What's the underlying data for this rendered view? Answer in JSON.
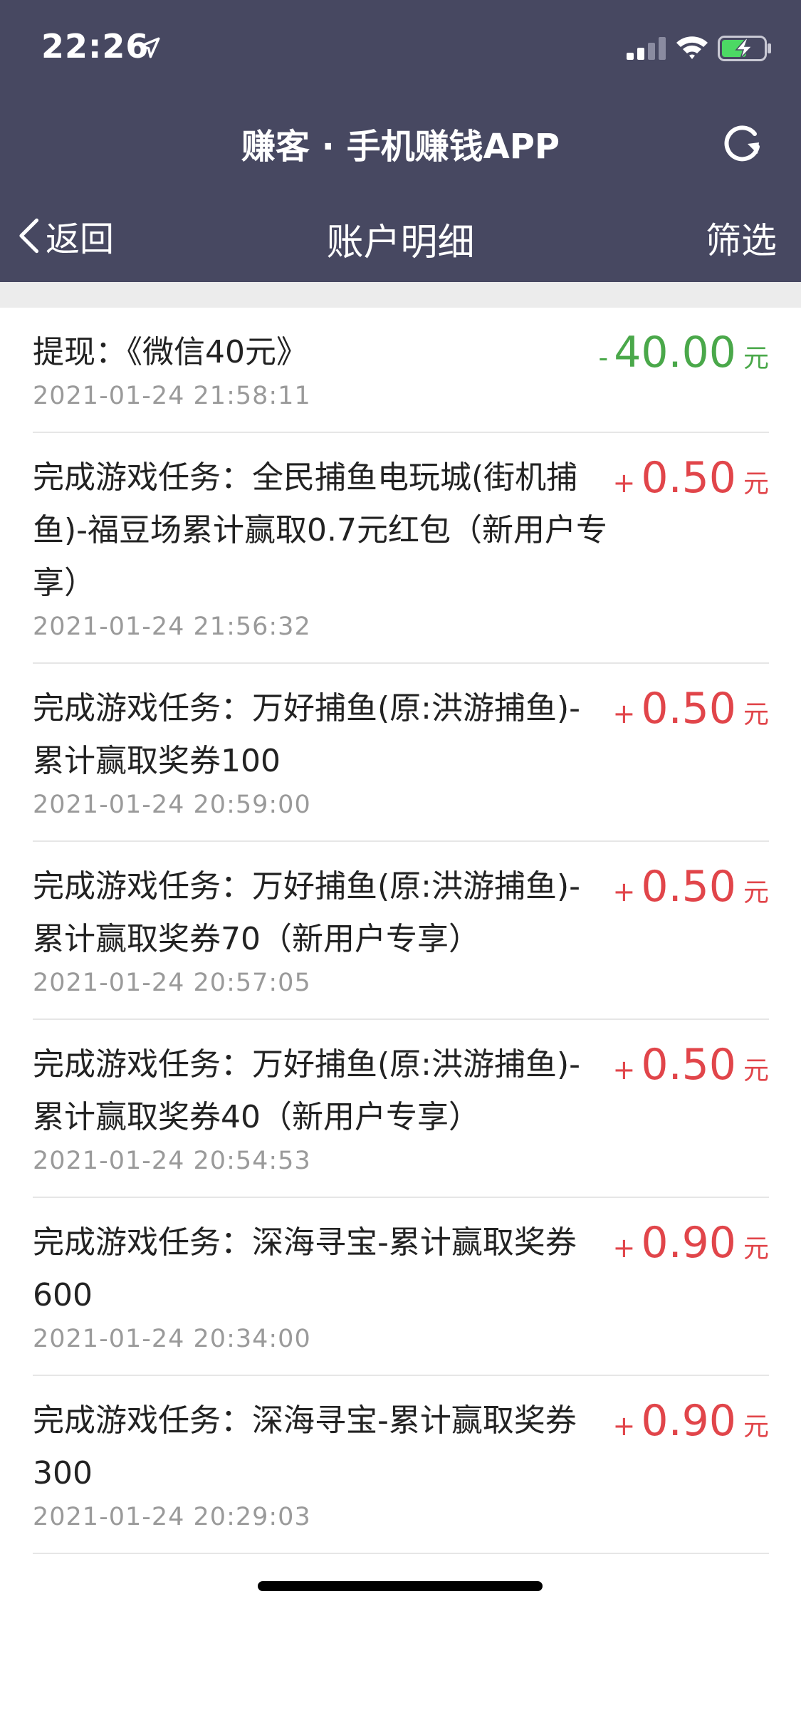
{
  "status_bar": {
    "time": "22:26"
  },
  "header": {
    "app_title": "赚客 · 手机赚钱APP",
    "back_label": "返回",
    "page_title": "账户明细",
    "filter_label": "筛选"
  },
  "colors": {
    "header_bg": "#474861",
    "positive": "#e1454a",
    "negative": "#4aa84a"
  },
  "records": [
    {
      "desc": "提现：《微信40元》",
      "date": "2021-01-24 21:58:11",
      "sign": "-",
      "amount": "40.00",
      "unit": "元",
      "type": "neg"
    },
    {
      "desc": "完成游戏任务：全民捕鱼电玩城(街机捕鱼)-福豆场累计赢取0.7元红包（新用户专享）",
      "date": "2021-01-24 21:56:32",
      "sign": "+",
      "amount": "0.50",
      "unit": "元",
      "type": "pos"
    },
    {
      "desc": "完成游戏任务：万好捕鱼(原:洪游捕鱼)-累计赢取奖券100",
      "date": "2021-01-24 20:59:00",
      "sign": "+",
      "amount": "0.50",
      "unit": "元",
      "type": "pos"
    },
    {
      "desc": "完成游戏任务：万好捕鱼(原:洪游捕鱼)-累计赢取奖券70（新用户专享）",
      "date": "2021-01-24 20:57:05",
      "sign": "+",
      "amount": "0.50",
      "unit": "元",
      "type": "pos"
    },
    {
      "desc": "完成游戏任务：万好捕鱼(原:洪游捕鱼)-累计赢取奖券40（新用户专享）",
      "date": "2021-01-24 20:54:53",
      "sign": "+",
      "amount": "0.50",
      "unit": "元",
      "type": "pos"
    },
    {
      "desc": "完成游戏任务：深海寻宝-累计赢取奖券600",
      "date": "2021-01-24 20:34:00",
      "sign": "+",
      "amount": "0.90",
      "unit": "元",
      "type": "pos"
    },
    {
      "desc": "完成游戏任务：深海寻宝-累计赢取奖券300",
      "date": "2021-01-24 20:29:03",
      "sign": "+",
      "amount": "0.90",
      "unit": "元",
      "type": "pos"
    }
  ]
}
